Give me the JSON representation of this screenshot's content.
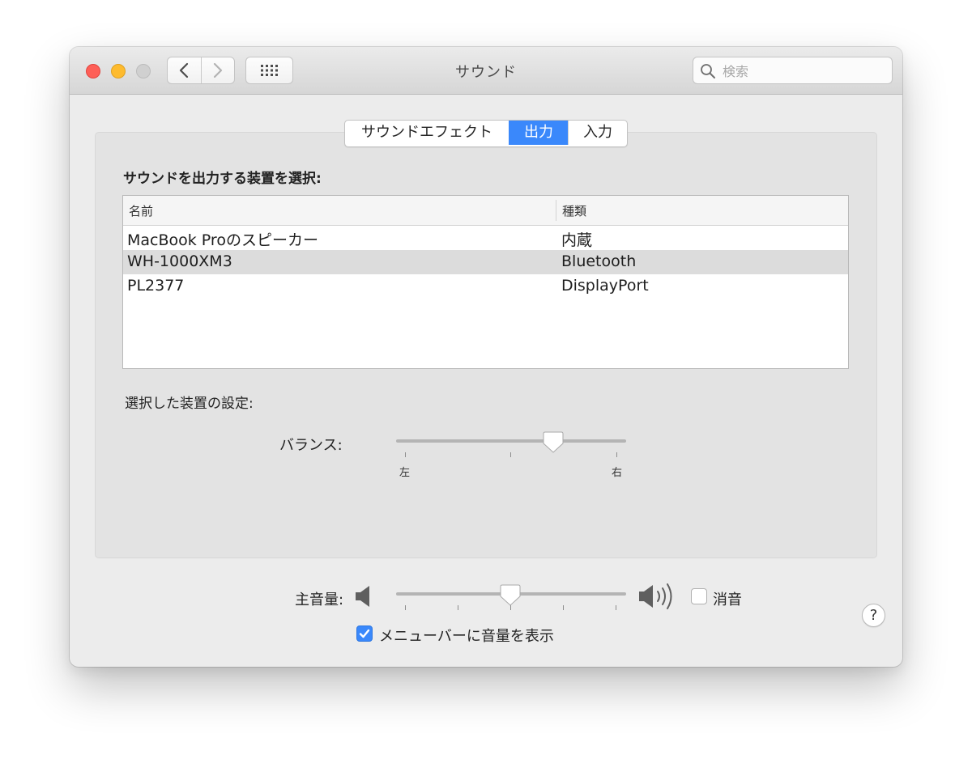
{
  "window": {
    "title": "サウンド",
    "search_placeholder": "検索"
  },
  "tabs": [
    {
      "label": "サウンドエフェクト",
      "active": false
    },
    {
      "label": "出力",
      "active": true
    },
    {
      "label": "入力",
      "active": false
    }
  ],
  "output": {
    "heading": "サウンドを出力する装置を選択:",
    "columns": {
      "name": "名前",
      "type": "種類"
    },
    "devices": [
      {
        "name": "MacBook Proのスピーカー",
        "type": "内蔵",
        "selected": false
      },
      {
        "name": "WH-1000XM3",
        "type": "Bluetooth",
        "selected": true
      },
      {
        "name": "PL2377",
        "type": "DisplayPort",
        "selected": false
      }
    ],
    "settings_label": "選択した装置の設定:",
    "balance": {
      "label": "バランス:",
      "left_label": "左",
      "right_label": "右",
      "value": 0.7
    },
    "help_label": "?"
  },
  "volume": {
    "label": "主音量:",
    "value": 0.5,
    "mute_label": "消音",
    "muted": false,
    "show_in_menubar_label": "メニューバーに音量を表示",
    "show_in_menubar": true
  },
  "colors": {
    "accent": "#3a88fb",
    "close": "#fe5f57",
    "minimize": "#febb2e"
  }
}
